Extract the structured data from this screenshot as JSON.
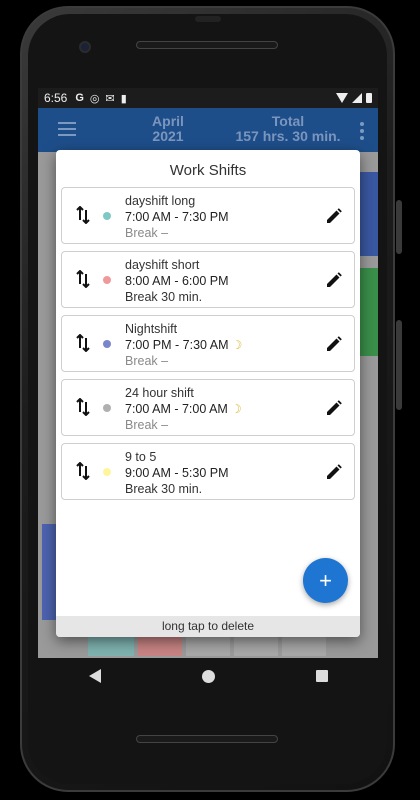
{
  "status_bar": {
    "time": "6:56",
    "icons": [
      "G",
      "◎",
      "✉",
      "▮"
    ]
  },
  "app_bar": {
    "month": "April",
    "year": "2021",
    "total_label": "Total",
    "total_value": "157 hrs. 30 min."
  },
  "dialog": {
    "title": "Work Shifts",
    "shifts": [
      {
        "name": "dayshift long",
        "time": "7:00 AM - 7:30 PM",
        "break": "Break –",
        "color": "#7fc8c4",
        "overnight": false,
        "break_muted": true
      },
      {
        "name": "dayshift short",
        "time": "8:00 AM - 6:00 PM",
        "break": "Break 30 min.",
        "color": "#ef9a9a",
        "overnight": false,
        "break_muted": false
      },
      {
        "name": "Nightshift",
        "time": "7:00 PM - 7:30 AM",
        "break": "Break –",
        "color": "#7986cb",
        "overnight": true,
        "break_muted": true
      },
      {
        "name": "24 hour shift",
        "time": "7:00 AM - 7:00 AM",
        "break": "Break –",
        "color": "#b0b0b0",
        "overnight": true,
        "break_muted": true
      },
      {
        "name": "9 to 5",
        "time": "9:00 AM - 5:30 PM",
        "break": "Break 30 min.",
        "color": "#fff59d",
        "overnight": false,
        "break_muted": false
      }
    ],
    "fab_label": "+",
    "footer_hint": "long tap to delete"
  },
  "colors": {
    "app_bar": "#1e4e8a",
    "fab": "#1f76d2"
  }
}
